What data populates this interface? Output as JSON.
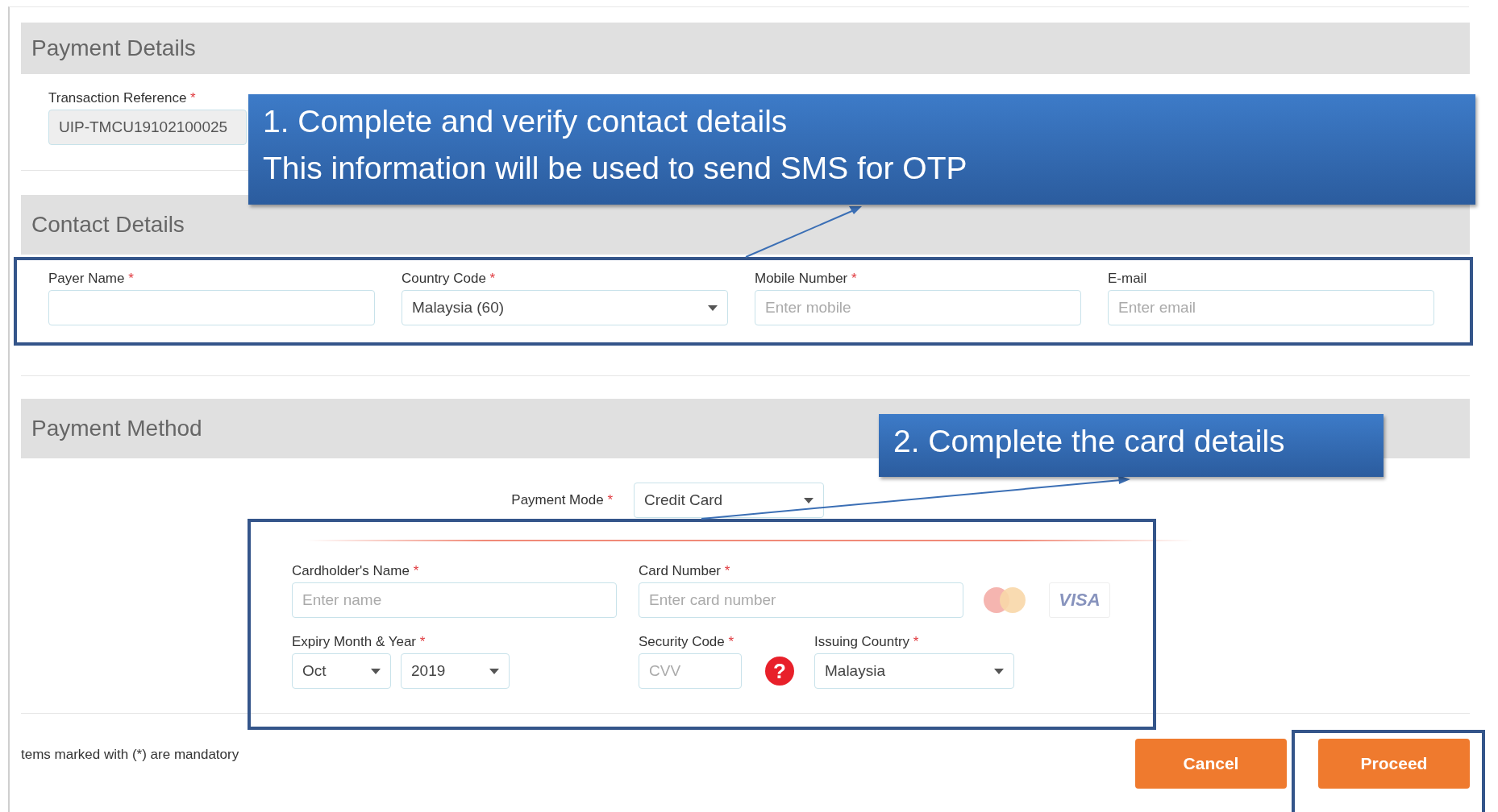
{
  "required_mark": "*",
  "payment_details": {
    "title": "Payment Details",
    "fields": [
      {
        "kind": "text",
        "label": "Transaction Reference",
        "required": true,
        "value": "UIP-TMCU19102100025",
        "disabled": true
      }
    ]
  },
  "contact_details": {
    "title": "Contact Details",
    "fields": [
      {
        "kind": "text",
        "label": "Payer Name",
        "required": true
      },
      {
        "kind": "select",
        "label": "Country Code",
        "required": true,
        "value": "Malaysia (60)"
      },
      {
        "kind": "text",
        "label": "Mobile Number",
        "required": true,
        "placeholder": "Enter mobile"
      },
      {
        "kind": "text",
        "label": "E-mail",
        "required": false,
        "placeholder": "Enter email"
      }
    ]
  },
  "payment_method": {
    "title": "Payment Method",
    "payment_mode": {
      "label": "Payment Mode",
      "required": true,
      "value": "Credit Card"
    },
    "card_rows": [
      [
        {
          "kind": "text",
          "label": "Cardholder's Name",
          "required": true,
          "placeholder": "Enter name"
        },
        {
          "kind": "text",
          "label": "Card Number",
          "required": true,
          "placeholder": "Enter card number"
        },
        {
          "kind": "logos",
          "visa_text": "VISA"
        }
      ],
      [
        {
          "kind": "date",
          "label": "Expiry Month & Year",
          "required": true,
          "month": "Oct",
          "year": "2019"
        },
        {
          "kind": "cvv",
          "label": "Security Code",
          "required": true,
          "placeholder": "CVV",
          "help": "?"
        },
        {
          "kind": "select",
          "label": "Issuing Country",
          "required": true,
          "value": "Malaysia"
        }
      ]
    ]
  },
  "footer_note": "tems marked with (*) are mandatory",
  "buttons": [
    {
      "label": "Cancel"
    },
    {
      "label": "Proceed"
    }
  ],
  "annotations": [
    {
      "lines": [
        "1. Complete and verify contact details",
        "This information will be used to send SMS for OTP"
      ]
    },
    {
      "lines": [
        "2. Complete the card details"
      ]
    }
  ]
}
